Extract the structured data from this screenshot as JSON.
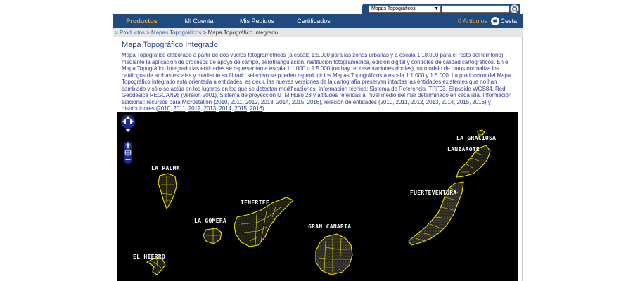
{
  "header": {
    "category_select": {
      "value": "Mapas Topográficos"
    },
    "search": {
      "placeholder": ""
    }
  },
  "nav": {
    "items": [
      {
        "label": "Productos",
        "active": true
      },
      {
        "label": "Mi Cuenta",
        "active": false
      },
      {
        "label": "Mis Pedidos",
        "active": false
      },
      {
        "label": "Certificados",
        "active": false
      }
    ],
    "articles": "0 Artículos",
    "basket": "Cesta"
  },
  "breadcrumb": {
    "items": [
      "> Productos",
      "> Mapas Topográficos"
    ],
    "current": "> Mapa Topográfico Integrado"
  },
  "page": {
    "title": "Mapa Topográfico Integrado",
    "description_part1": "Mapa Topográfico elaborado a partir de dos vuelos fotogramétricos (a escala 1:5.000 para las zonas urbanas y a escala 1:18.000 para el resto del territorio) mediante la aplicación de procesos de apoyo de campo, aerotriangulación, restitución fotogramétrica, edición digital y controles de calidad cartográficos. En el Mapa Topográfico Integrado las entidades se representan a escala 1:1.000 o 1:5.000 (no hay representaciones dobles), su modelo de datos normaliza los catálogos de ambas escalas y mediante su filtrado selectivo se pueden reproducir los Mapas Topográficos a escala 1:1.000 y 1:5.000. La producción del Mapa Topográfico Integrado está orientada a entidades, es decir, las nuevas versiones de la cartografía preservan intactas las entidades existentes que no han cambiado y sólo se actúa en los lugares en los que se detectan modificaciones. Información técnica: Sistema de Referencia ITRF93, Elipsoide WGS84, Red Geodésica REGCAN95 (versión 2001), Sistema de proyección UTM Huso 28 y altitudes referidas al nivel medio del mar determinado en cada isla. Información adicional: recursos para Microstation (",
    "years_microstation": [
      "2010",
      "2011",
      "2012",
      "2013",
      "2014",
      "2015",
      "2016"
    ],
    "description_part2": "), relación de entidades (",
    "years_entidades": [
      "2010",
      "2011",
      "2012",
      "2013",
      "2014",
      "2015",
      "2016"
    ],
    "description_part3": ") y distribuidores (",
    "years_distribuidores": [
      "2010",
      "2011",
      "2012",
      "2013",
      "2014",
      "2015",
      "2016"
    ],
    "description_part4": ")."
  },
  "map": {
    "background": "#000000",
    "outline_color": "#f2e600",
    "islands": [
      {
        "id": "la-graciosa",
        "label": "LA GRACIOSA"
      },
      {
        "id": "lanzarote",
        "label": "LANZAROTE"
      },
      {
        "id": "la-palma",
        "label": "LA PALMA"
      },
      {
        "id": "fuerteventura",
        "label": "FUERTEVENTURA"
      },
      {
        "id": "tenerife",
        "label": "TENERIFE"
      },
      {
        "id": "la-gomera",
        "label": "LA GOMERA"
      },
      {
        "id": "gran-canaria",
        "label": "GRAN CANARIA"
      },
      {
        "id": "el-hierro",
        "label": "EL HIERRO"
      }
    ]
  },
  "colors": {
    "nav_bg": "#1f4b80",
    "accent": "#f5a623",
    "link": "#1f3d8a"
  }
}
